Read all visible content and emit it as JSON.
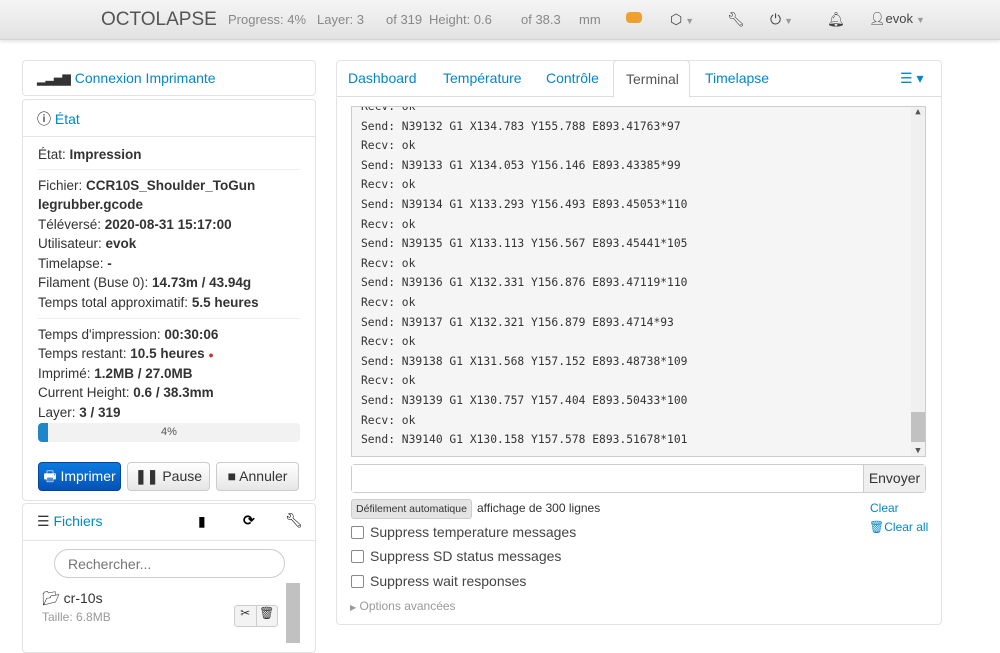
{
  "navbar": {
    "brand": "OCTOLAPSE",
    "progress": "Progress: 4%",
    "layer": "Layer: 3",
    "layer_of": "of 319",
    "height": "Height: 0.6",
    "height_of": "of 38.3",
    "unit": "mm",
    "user": "evok"
  },
  "connection": {
    "title": "Connexion Imprimante"
  },
  "state": {
    "title": "État",
    "rows": [
      {
        "label": "État: ",
        "value": "Impression"
      },
      {
        "label": "Fichier: ",
        "value": "CCR10S_Shoulder_ToGun"
      },
      {
        "label": "",
        "value": "legrubber.gcode"
      },
      {
        "label": "Téléversé: ",
        "value": "2020-08-31 15:17:00"
      },
      {
        "label": "Utilisateur: ",
        "value": "evok"
      },
      {
        "label": "Timelapse: ",
        "value": "-"
      },
      {
        "label": "Filament (Buse 0): ",
        "value": "14.73m / 43.94g"
      },
      {
        "label": "Temps total approximatif: ",
        "value": "5.5 heures"
      },
      {
        "label": "Temps d'impression: ",
        "value": "00:30:06"
      },
      {
        "label": "Temps restant: ",
        "value": "10.5 heures"
      },
      {
        "label": "Imprimé: ",
        "value": "1.2MB / 27.0MB"
      },
      {
        "label": "Current Height: ",
        "value": "0.6 / 38.3mm"
      },
      {
        "label": "Layer: ",
        "value": "3 / 319"
      }
    ],
    "progress_percent": 4,
    "progress_label": "4%",
    "buttons": {
      "print": "Imprimer",
      "pause": "Pause",
      "cancel": "Annuler"
    }
  },
  "files": {
    "title": "Fichiers",
    "search_placeholder": "Rechercher...",
    "items": [
      {
        "name": "cr-10s",
        "size": "Taille: 6.8MB"
      }
    ]
  },
  "tabs": [
    "Dashboard",
    "Température",
    "Contrôle",
    "Terminal",
    "Timelapse"
  ],
  "active_tab": "Terminal",
  "terminal": {
    "lines": [
      "Recv: ok",
      "Send: N39132 G1 X134.783 Y155.788 E893.41763*97",
      "Recv: ok",
      "Send: N39133 G1 X134.053 Y156.146 E893.43385*99",
      "Recv: ok",
      "Send: N39134 G1 X133.293 Y156.493 E893.45053*110",
      "Recv: ok",
      "Send: N39135 G1 X133.113 Y156.567 E893.45441*105",
      "Recv: ok",
      "Send: N39136 G1 X132.331 Y156.876 E893.47119*110",
      "Recv: ok",
      "Send: N39137 G1 X132.321 Y156.879 E893.4714*93",
      "Recv: ok",
      "Send: N39138 G1 X131.568 Y157.152 E893.48738*109",
      "Recv: ok",
      "Send: N39139 G1 X130.757 Y157.404 E893.50433*100",
      "Recv: ok",
      "Send: N39140 G1 X130.158 Y157.578 E893.51678*101"
    ],
    "command_value": "",
    "send": "Envoyer",
    "autoscroll": "Défilement automatique",
    "line_count": "affichage de 300 lignes",
    "clear": "Clear",
    "clear_all": "Clear all",
    "options": [
      "Suppress temperature messages",
      "Suppress SD status messages",
      "Suppress wait responses"
    ],
    "advanced": "Options avancées"
  },
  "colors": {
    "link": "#0088cc",
    "primary": "#0a64c8",
    "progress": "#1f87c9",
    "accent": "#f0a030"
  }
}
